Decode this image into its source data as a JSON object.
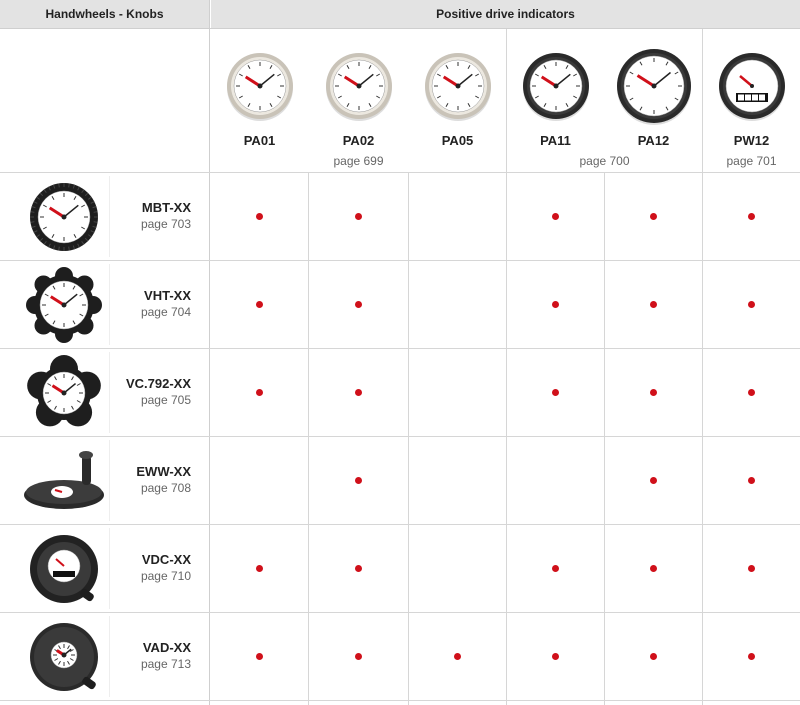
{
  "header": {
    "left_title": "Handwheels - Knobs",
    "right_title": "Positive drive indicators"
  },
  "indicators": [
    {
      "code": "PA01",
      "style": "steel"
    },
    {
      "code": "PA02",
      "style": "steel"
    },
    {
      "code": "PA05",
      "style": "steel"
    },
    {
      "code": "PA11",
      "style": "black"
    },
    {
      "code": "PA12",
      "style": "black"
    },
    {
      "code": "PW12",
      "style": "counter"
    }
  ],
  "indicator_groups": [
    {
      "page": "page 699"
    },
    {
      "page": "page 700"
    },
    {
      "page": "page 701"
    }
  ],
  "rows": [
    {
      "name": "MBT-XX",
      "page": "page 703",
      "icon": "round-handwheel-with-gauge",
      "marks": [
        true,
        true,
        false,
        true,
        true,
        true
      ]
    },
    {
      "name": "VHT-XX",
      "page": "page 704",
      "icon": "lobed-handwheel-with-gauge",
      "marks": [
        true,
        true,
        false,
        true,
        true,
        true
      ]
    },
    {
      "name": "VC.792-XX",
      "page": "page 705",
      "icon": "five-lobe-knob-with-gauge",
      "marks": [
        true,
        true,
        false,
        true,
        true,
        true
      ]
    },
    {
      "name": "EWW-XX",
      "page": "page 708",
      "icon": "flat-disc-handwheel-with-handle",
      "marks": [
        false,
        true,
        false,
        false,
        true,
        true
      ]
    },
    {
      "name": "VDC-XX",
      "page": "page 710",
      "icon": "spoked-handwheel-with-counter",
      "marks": [
        true,
        true,
        false,
        true,
        true,
        true
      ]
    },
    {
      "name": "VAD-XX",
      "page": "page 713",
      "icon": "solid-handwheel-with-gauge",
      "marks": [
        true,
        true,
        true,
        true,
        true,
        true
      ]
    }
  ],
  "colors": {
    "mark": "#d0101a",
    "header_bg": "#e3e3e3",
    "grid_line": "#d6d6d6"
  }
}
